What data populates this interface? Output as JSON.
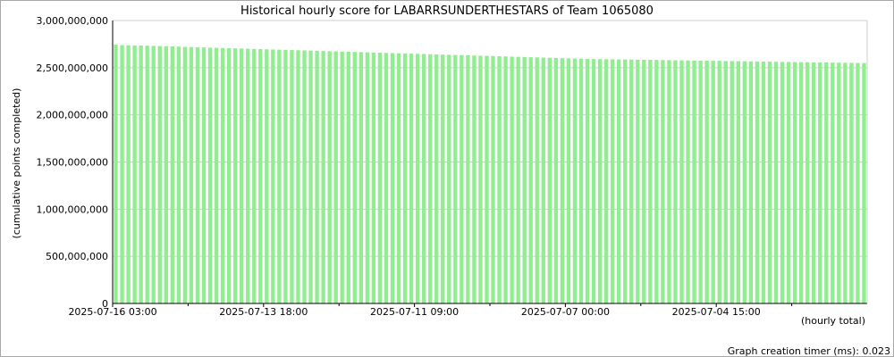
{
  "chart_data": {
    "type": "bar",
    "title": "Historical hourly score for LABARRSUNDERTHESTARS of Team 1065080",
    "ylabel": "(cumulative points completed)",
    "xlabel": "(hourly total)",
    "footer": "Graph creation timer (ms): 0.023",
    "ylim": [
      0,
      3000000000
    ],
    "yticks": [
      {
        "value": 0,
        "label": "0"
      },
      {
        "value": 500000000,
        "label": "500,000,000"
      },
      {
        "value": 1000000000,
        "label": "1,000,000,000"
      },
      {
        "value": 1500000000,
        "label": "1,500,000,000"
      },
      {
        "value": 2000000000,
        "label": "2,000,000,000"
      },
      {
        "value": 2500000000,
        "label": "2,500,000,000"
      },
      {
        "value": 3000000000,
        "label": "3,000,000,000"
      }
    ],
    "xtick_labels": [
      {
        "index": 0,
        "label": "2025-07-16 03:00"
      },
      {
        "index": 24,
        "label": "2025-07-13 18:00"
      },
      {
        "index": 48,
        "label": "2025-07-11 09:00"
      },
      {
        "index": 72,
        "label": "2025-07-07 00:00"
      },
      {
        "index": 96,
        "label": "2025-07-04 15:00"
      }
    ],
    "minor_tick_indices": [
      12,
      36,
      60,
      84,
      108
    ],
    "grid": true,
    "bar_color": "#90ee90",
    "values": [
      2745000000,
      2740000000,
      2738000000,
      2736000000,
      2735000000,
      2733000000,
      2731000000,
      2729000000,
      2727000000,
      2725000000,
      2723000000,
      2721000000,
      2719000000,
      2717000000,
      2715000000,
      2713000000,
      2711000000,
      2709000000,
      2707000000,
      2705000000,
      2703000000,
      2701000000,
      2699000000,
      2697000000,
      2695000000,
      2693000000,
      2691000000,
      2689000000,
      2687000000,
      2685000000,
      2683000000,
      2681000000,
      2679000000,
      2677000000,
      2675000000,
      2673000000,
      2671000000,
      2669000000,
      2667000000,
      2665000000,
      2663000000,
      2661000000,
      2659000000,
      2657000000,
      2655000000,
      2653000000,
      2651000000,
      2649000000,
      2647000000,
      2645000000,
      2643000000,
      2641000000,
      2639000000,
      2637000000,
      2635000000,
      2633000000,
      2631000000,
      2629000000,
      2627000000,
      2625000000,
      2623000000,
      2621000000,
      2619000000,
      2617000000,
      2615000000,
      2613000000,
      2611000000,
      2609000000,
      2607000000,
      2605000000,
      2603000000,
      2601000000,
      2599000000,
      2597000000,
      2595000000,
      2593000000,
      2592000000,
      2591000000,
      2590000000,
      2589000000,
      2588000000,
      2587000000,
      2586000000,
      2585000000,
      2584000000,
      2583000000,
      2582000000,
      2581000000,
      2580000000,
      2579000000,
      2578000000,
      2577000000,
      2576000000,
      2575000000,
      2574000000,
      2573000000,
      2572000000,
      2571000000,
      2570000000,
      2569000000,
      2568000000,
      2567000000,
      2566000000,
      2565000000,
      2564000000,
      2563000000,
      2562000000,
      2561000000,
      2560000000,
      2559000000,
      2558000000,
      2557000000,
      2556000000,
      2555000000,
      2554000000,
      2553000000,
      2552000000,
      2551000000,
      2550000000,
      2549000000
    ]
  }
}
